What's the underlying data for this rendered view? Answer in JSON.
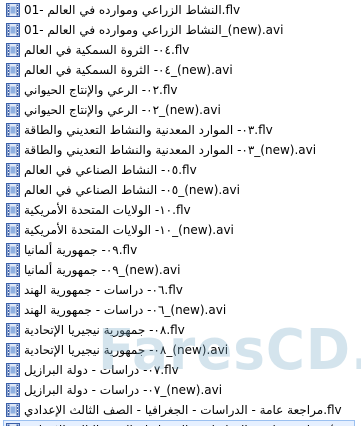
{
  "files": [
    "01- النشاط الزراعي وموارده في العالم.flv",
    "01- النشاط الزراعي وموارده في العالم_(new).avi",
    "٠٤- الثروة السمكية في العالم.flv",
    "٠٤- الثروة السمكية في العالم_(new).avi",
    "٠٢- الرعي والإنتاج الحيواني.flv",
    "٠٢- الرعي والإنتاج الحيواني_(new).avi",
    "٠٣- الموارد المعدنية والنشاط التعديني والطاقة.flv",
    "٠٣- الموارد المعدنية والنشاط التعديني والطاقة_(new).avi",
    "٠٥- النشاط الصناعي في العالم.flv",
    "٠٥- النشاط الصناعي في العالم_(new).avi",
    "١٠- الولايات المتحدة الأمريكية.flv",
    "١٠- الولايات المتحدة الأمريكية_(new).avi",
    "٠٩- جمهورية ألمانيا.flv",
    "٠٩- جمهورية ألمانيا_(new).avi",
    "٠٦- دراسات - جمهورية الهند.flv",
    "٠٦- دراسات - جمهورية الهند_(new).avi",
    "٠٨- جمهورية نيجيريا الإتحادية.flv",
    "٠٨- جمهورية نيجيريا الإتحادية_(new).avi",
    "٠٧- دراسات - دولة البرازيل.flv",
    "٠٧- دراسات - دولة البرازيل_(new).avi",
    "مراجعة عامة - الدراسات - الجغرافيا - الصف الثالث الإعدادي.flv",
    "مراجعة عامة - الدراسات - الجغرافيا - الصف الثالث الإعدادي_(new).avi"
  ],
  "watermark": "FaresCD.Com",
  "colors": {
    "icon_frame": "#3b5fa8",
    "icon_fill": "#dfe8f6",
    "selection": "#e6f0ff"
  },
  "icon_name": "video-file-icon"
}
